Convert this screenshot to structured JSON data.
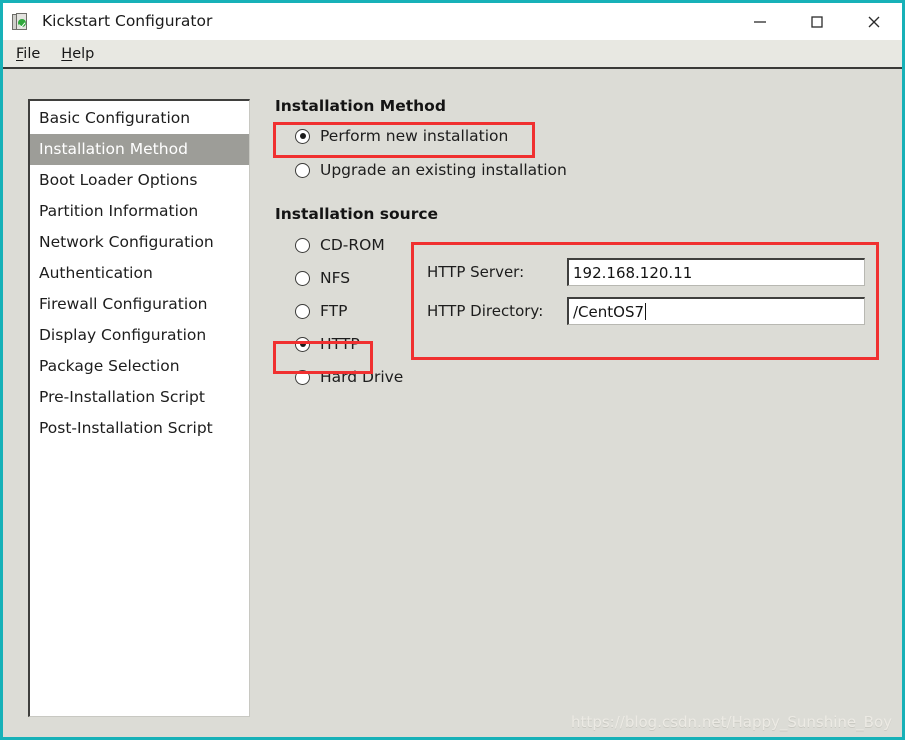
{
  "window": {
    "title": "Kickstart Configurator",
    "app_icon": "kickstart-app-icon",
    "accent_color": "#17b1b8",
    "controls": {
      "minimize": "minimize-icon",
      "maximize": "maximize-icon",
      "close": "close-icon"
    }
  },
  "menubar": {
    "items": [
      {
        "label": "File",
        "mnemonic": "F"
      },
      {
        "label": "Help",
        "mnemonic": "H"
      }
    ]
  },
  "sidebar": {
    "selected_index": 1,
    "items": [
      {
        "label": "Basic Configuration"
      },
      {
        "label": "Installation Method"
      },
      {
        "label": "Boot Loader Options"
      },
      {
        "label": "Partition Information"
      },
      {
        "label": "Network Configuration"
      },
      {
        "label": "Authentication"
      },
      {
        "label": "Firewall Configuration"
      },
      {
        "label": "Display Configuration"
      },
      {
        "label": "Package Selection"
      },
      {
        "label": "Pre-Installation Script"
      },
      {
        "label": "Post-Installation Script"
      }
    ]
  },
  "installation_method": {
    "title": "Installation Method",
    "options": [
      {
        "label": "Perform new installation",
        "checked": true
      },
      {
        "label": "Upgrade an existing installation",
        "checked": false
      }
    ]
  },
  "installation_source": {
    "title": "Installation source",
    "options": [
      {
        "label": "CD-ROM",
        "checked": false
      },
      {
        "label": "NFS",
        "checked": false
      },
      {
        "label": "FTP",
        "checked": false
      },
      {
        "label": "HTTP",
        "checked": true
      },
      {
        "label": "Hard Drive",
        "checked": false
      }
    ],
    "http": {
      "server_label": "HTTP Server:",
      "server_value": "192.168.120.11",
      "directory_label": "HTTP Directory:",
      "directory_value": "/CentOS7"
    }
  },
  "annotations": {
    "color": "#f03030",
    "boxes": [
      {
        "name": "perform-new-installation"
      },
      {
        "name": "http-source-radio"
      },
      {
        "name": "http-server-fields"
      }
    ]
  },
  "watermark": {
    "text": "https://blog.csdn.net/Happy_Sunshine_Boy"
  }
}
